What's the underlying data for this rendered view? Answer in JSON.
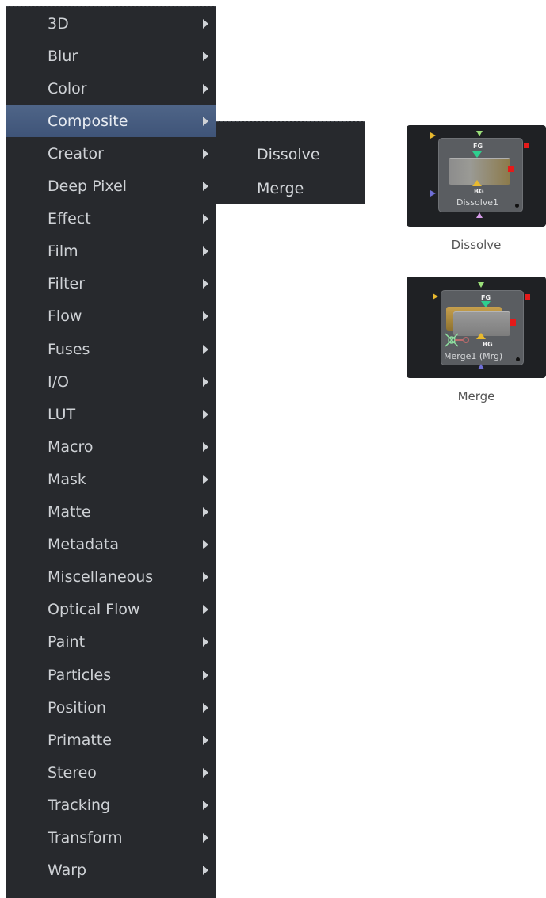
{
  "menu": {
    "items": [
      {
        "label": "3D"
      },
      {
        "label": "Blur"
      },
      {
        "label": "Color"
      },
      {
        "label": "Composite",
        "active": true
      },
      {
        "label": "Creator"
      },
      {
        "label": "Deep Pixel"
      },
      {
        "label": "Effect"
      },
      {
        "label": "Film"
      },
      {
        "label": "Filter"
      },
      {
        "label": "Flow"
      },
      {
        "label": "Fuses"
      },
      {
        "label": "I/O"
      },
      {
        "label": "LUT"
      },
      {
        "label": "Macro"
      },
      {
        "label": "Mask"
      },
      {
        "label": "Matte"
      },
      {
        "label": "Metadata"
      },
      {
        "label": "Miscellaneous"
      },
      {
        "label": "Optical Flow"
      },
      {
        "label": "Paint"
      },
      {
        "label": "Particles"
      },
      {
        "label": "Position"
      },
      {
        "label": "Primatte"
      },
      {
        "label": "Stereo"
      },
      {
        "label": "Tracking"
      },
      {
        "label": "Transform"
      },
      {
        "label": "Warp"
      }
    ]
  },
  "submenu": {
    "items": [
      {
        "label": "Dissolve"
      },
      {
        "label": "Merge"
      }
    ]
  },
  "nodes": {
    "dissolve": {
      "name": "Dissolve1",
      "fg_label": "FG",
      "bg_label": "BG",
      "caption": "Dissolve"
    },
    "merge": {
      "name": "Merge1  (Mrg)",
      "fg_label": "FG",
      "bg_label": "BG",
      "caption": "Merge"
    }
  },
  "colors": {
    "menu_bg": "#27292d",
    "active_bg": "#46597c",
    "output_red": "#e41a1a",
    "fg_green": "#2ecf8f",
    "bg_yellow": "#e8b92e",
    "mask_blue": "#6f6fd6"
  }
}
